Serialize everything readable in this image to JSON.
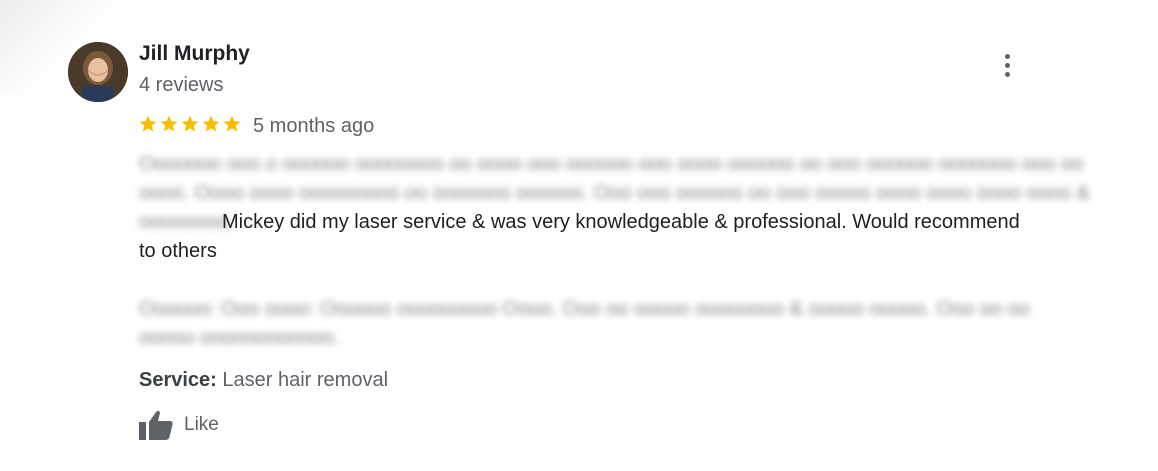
{
  "review": {
    "author_name": "Jill Murphy",
    "author_review_count": "4 reviews",
    "rating": 5,
    "rating_max": 5,
    "time_ago": "5 months ago",
    "text_visible": "Mickey did my laser service & was very knowledgeable & professional. Would recommend to others",
    "service_label": "Service:",
    "service_value": "Laser hair removal",
    "like_label": "Like"
  },
  "colors": {
    "star": "#fbbc04",
    "primary_text": "#202124",
    "secondary_text": "#5f6368"
  },
  "icons": {
    "menu": "more-vert-icon",
    "like": "thumb-up-icon",
    "star": "star-icon"
  }
}
